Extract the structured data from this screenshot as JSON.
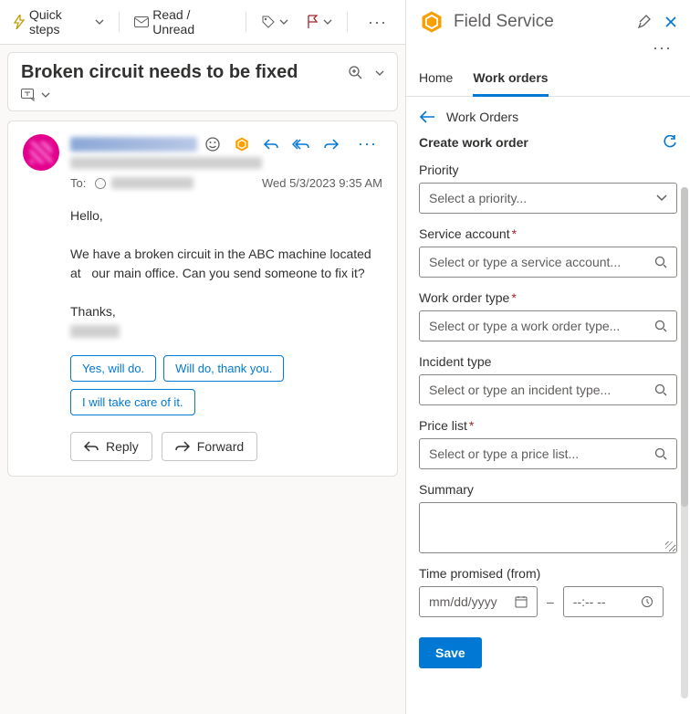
{
  "toolbar": {
    "quick_steps": "Quick steps",
    "read_unread": "Read / Unread"
  },
  "subject": "Broken circuit needs to be fixed",
  "email": {
    "to_label": "To:",
    "timestamp": "Wed 5/3/2023 9:35 AM",
    "greeting": "Hello,",
    "body": "We have a broken circuit in the ABC machine located at   our main office. Can you send someone to fix it?",
    "thanks": "Thanks,",
    "suggestions": [
      "Yes, will do.",
      "Will do, thank you.",
      "I will take care of it."
    ],
    "reply": "Reply",
    "forward": "Forward"
  },
  "panel": {
    "app_title": "Field Service",
    "tabs": {
      "home": "Home",
      "work_orders": "Work orders"
    },
    "breadcrumb": "Work Orders",
    "create_title": "Create work order",
    "fields": {
      "priority": {
        "label": "Priority",
        "placeholder": "Select a priority..."
      },
      "service_account": {
        "label": "Service account",
        "placeholder": "Select or type a service account..."
      },
      "work_order_type": {
        "label": "Work order type",
        "placeholder": "Select or type a work order type..."
      },
      "incident_type": {
        "label": "Incident type",
        "placeholder": "Select or type an incident type..."
      },
      "price_list": {
        "label": "Price list",
        "placeholder": "Select or type a price list..."
      },
      "summary": {
        "label": "Summary"
      },
      "time_promised": {
        "label": "Time promised (from)",
        "date_placeholder": "mm/dd/yyyy",
        "time_placeholder": "--:--  --"
      }
    },
    "save": "Save"
  }
}
